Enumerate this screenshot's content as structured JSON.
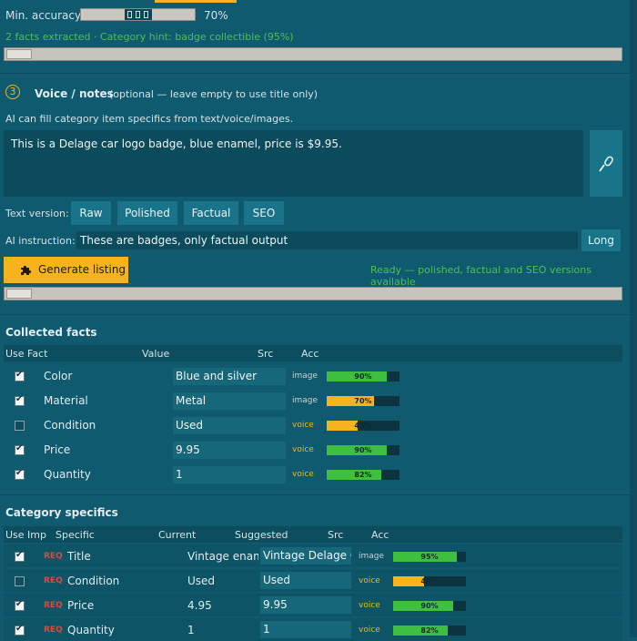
{
  "accuracy": {
    "label": "Min. accuracy:",
    "value": "70%",
    "level": 0.7
  },
  "facts_status": "2 facts extracted · Category hint: badge collectible (95%)",
  "voice": {
    "step": "3",
    "title": "Voice / notes",
    "hint": "(optional — leave empty to use title only)",
    "info": "AI can fill category item specifics from text/voice/images.",
    "notes": "This is a Delage car logo badge, blue enamel, price is $9.95."
  },
  "text_version": {
    "label": "Text version:",
    "options": [
      "Raw",
      "Polished",
      "Factual",
      "SEO"
    ]
  },
  "ai_instruction": {
    "label": "AI instruction:",
    "value": "These are badges, only factual output",
    "button": "Long"
  },
  "generate": {
    "label": "Generate listing",
    "status": "Ready — polished, factual and SEO versions available"
  },
  "collected": {
    "title": "Collected facts",
    "headers": {
      "use": "Use",
      "fact": "Fact",
      "value": "Value",
      "src": "Src",
      "acc": "Acc"
    },
    "rows": [
      {
        "checked": true,
        "fact": "Color",
        "value": "Blue and silver",
        "src": "image",
        "acc": 0.9,
        "acc_label": "90%",
        "color": "#3fbf3f"
      },
      {
        "checked": true,
        "fact": "Material",
        "value": "Metal",
        "src": "image",
        "acc": 0.7,
        "acc_label": "70%",
        "color": "#f5b41d"
      },
      {
        "checked": false,
        "fact": "Condition",
        "value": "Used",
        "src": "voice",
        "acc": 0.46,
        "acc_label": "46%",
        "color": "#f5b41d"
      },
      {
        "checked": true,
        "fact": "Price",
        "value": "9.95",
        "src": "voice",
        "acc": 0.9,
        "acc_label": "90%",
        "color": "#3fbf3f"
      },
      {
        "checked": true,
        "fact": "Quantity",
        "value": "1",
        "src": "voice",
        "acc": 0.82,
        "acc_label": "82%",
        "color": "#3fbf3f"
      }
    ]
  },
  "specifics": {
    "title": "Category specifics",
    "headers": {
      "use": "Use",
      "imp": "Imp",
      "specific": "Specific",
      "current": "Current",
      "suggested": "Suggested",
      "src": "Src",
      "acc": "Acc"
    },
    "rows": [
      {
        "checked": true,
        "imp": "REQ",
        "specific": "Title",
        "current": "Vintage ename",
        "suggested": "Vintage Delage Car",
        "src": "image",
        "acc": 0.95,
        "acc_label": "95%",
        "color": "#3fbf3f"
      },
      {
        "checked": false,
        "imp": "REQ",
        "specific": "Condition",
        "current": "Used",
        "suggested": "Used",
        "src": "voice",
        "acc": 0.46,
        "acc_label": "46%",
        "color": "#f5b41d"
      },
      {
        "checked": true,
        "imp": "REQ",
        "specific": "Price",
        "current": "4.95",
        "suggested": "9.95",
        "src": "voice",
        "acc": 0.9,
        "acc_label": "90%",
        "color": "#3fbf3f"
      },
      {
        "checked": true,
        "imp": "REQ",
        "specific": "Quantity",
        "current": "1",
        "suggested": "1",
        "src": "voice",
        "acc": 0.82,
        "acc_label": "82%",
        "color": "#3fbf3f"
      }
    ]
  },
  "colors": {
    "image_src": "#c8d4d8",
    "voice_src": "#f5b41d",
    "accent": "#f5b41d",
    "status_green": "#4fbf4f",
    "req": "#e0483c"
  },
  "icons": {
    "mic": "microphone-icon",
    "puzzle": "puzzle-icon"
  }
}
